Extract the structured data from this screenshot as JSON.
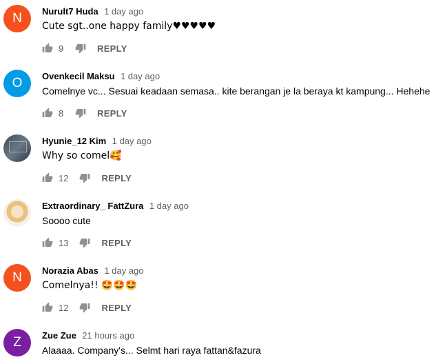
{
  "colors": {
    "avatar_orange": "#f4511e",
    "avatar_blue": "#039be5",
    "avatar_purple": "#7b1fa2"
  },
  "icons": {
    "like": "thumbs-up-icon",
    "dislike": "thumbs-down-icon"
  },
  "comments": [
    {
      "author": "Nurult7 Huda",
      "time": "1 day ago",
      "text": "Cute sgt..one happy family♥♥♥♥♥",
      "likes": "9",
      "reply": "REPLY",
      "avatar_letter": "N"
    },
    {
      "author": "Ovenkecil Maksu",
      "time": "1 day ago",
      "text": "Comelnye vc...  Sesuai keadaan semasa..  kite berangan je la beraya kt kampung... Hehehe",
      "likes": "8",
      "reply": "REPLY",
      "avatar_letter": "O"
    },
    {
      "author": "Hyunie_12 Kim",
      "time": "1 day ago",
      "text": "Why so comel🥰",
      "likes": "12",
      "reply": "REPLY",
      "avatar_letter": ""
    },
    {
      "author": "Extraordinary_ FattZura",
      "time": "1 day ago",
      "text": "Soooo cute",
      "likes": "13",
      "reply": "REPLY",
      "avatar_letter": ""
    },
    {
      "author": "Norazia Abas",
      "time": "1 day ago",
      "text": "Comelnya!! 🤩🤩🤩",
      "likes": "12",
      "reply": "REPLY",
      "avatar_letter": "N"
    },
    {
      "author": "Zue Zue",
      "time": "21 hours ago",
      "text": "Alaaaa. Company's... Selmt hari raya fattan&fazura",
      "likes": "",
      "reply": "",
      "avatar_letter": "Z"
    }
  ]
}
